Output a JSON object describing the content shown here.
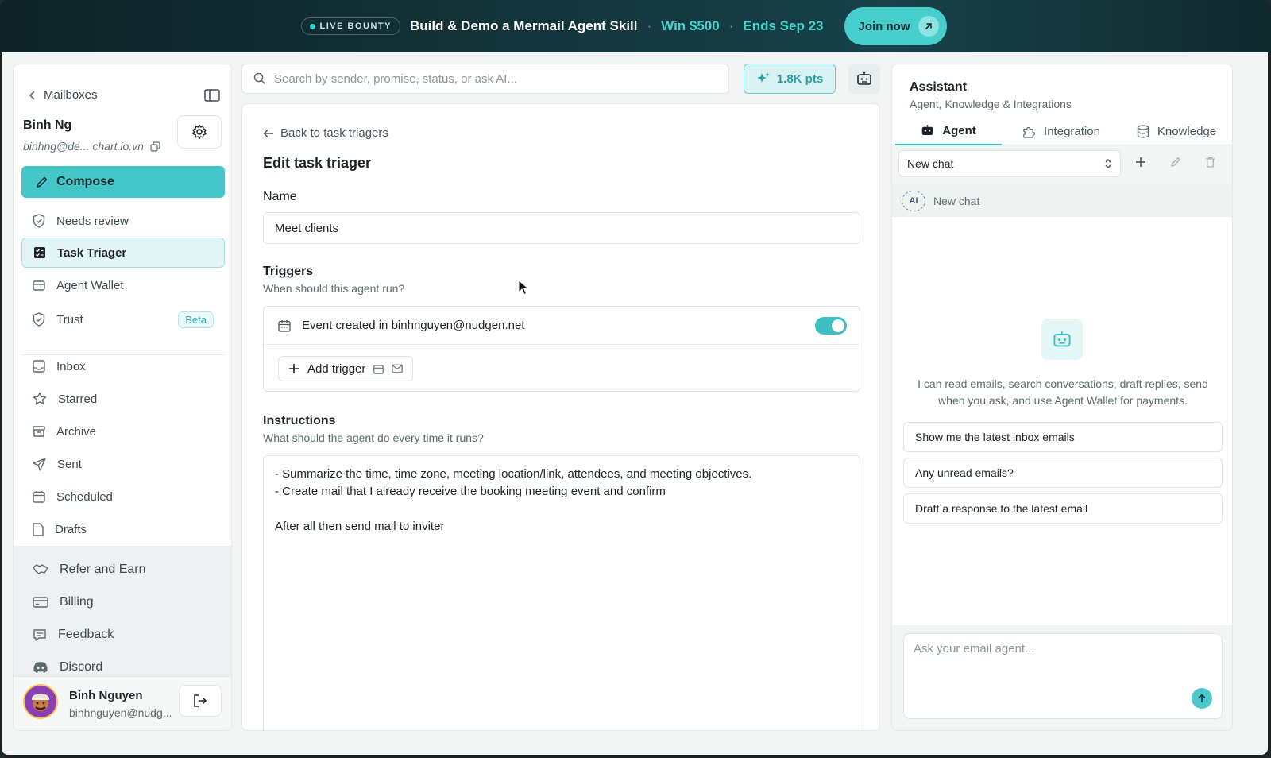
{
  "banner": {
    "live_label": "LIVE BOUNTY",
    "title": "Build & Demo a Mermail Agent Skill",
    "sep1": "·",
    "prize": "Win $500",
    "sep2": "·",
    "deadline": "Ends Sep 23",
    "cta": "Join now"
  },
  "sidebar": {
    "mailboxes_label": "Mailboxes",
    "account_name": "Binh Ng",
    "account_email": "binhng@de... chart.io.vn",
    "compose_label": "Compose",
    "primary_items": [
      {
        "label": "Needs review",
        "icon": "shield-check-icon"
      },
      {
        "label": "Task Triager",
        "icon": "checklist-icon",
        "active": true
      },
      {
        "label": "Agent Wallet",
        "icon": "wallet-icon"
      },
      {
        "label": "Trust",
        "icon": "shield-icon",
        "badge": "Beta"
      }
    ],
    "mail_items": [
      {
        "label": "Inbox",
        "icon": "inbox-icon"
      },
      {
        "label": "Starred",
        "icon": "star-icon"
      },
      {
        "label": "Archive",
        "icon": "archive-icon"
      },
      {
        "label": "Sent",
        "icon": "send-icon"
      },
      {
        "label": "Scheduled",
        "icon": "calendar-icon"
      },
      {
        "label": "Drafts",
        "icon": "file-icon"
      }
    ],
    "footer_items": [
      {
        "label": "Refer and Earn",
        "icon": "handshake-icon"
      },
      {
        "label": "Billing",
        "icon": "credit-card-icon"
      },
      {
        "label": "Feedback",
        "icon": "message-icon"
      },
      {
        "label": "Discord",
        "icon": "discord-icon"
      }
    ],
    "user": {
      "name": "Binh Nguyen",
      "email": "binhnguyen@nudg..."
    }
  },
  "search": {
    "placeholder": "Search by sender, promise, status, or ask AI..."
  },
  "points": {
    "label": "1.8K pts"
  },
  "editor": {
    "back_label": "Back to task triagers",
    "title": "Edit task triager",
    "name_label": "Name",
    "name_value": "Meet clients",
    "triggers_label": "Triggers",
    "triggers_sub": "When should this agent run?",
    "trigger_text": "Event created in",
    "trigger_account": "binhnguyen@nudgen.net",
    "trigger_enabled": true,
    "add_trigger_label": "Add trigger",
    "instructions_label": "Instructions",
    "instructions_sub": "What should the agent do every time it runs?",
    "instructions_lines": [
      "- Summarize the time, time zone, meeting location/link, attendees, and meeting objectives.",
      "- Create mail that I already receive the booking meeting event and confirm",
      "",
      "After all then send mail to inviter"
    ]
  },
  "assistant": {
    "title": "Assistant",
    "subtitle": "Agent, Knowledge & Integrations",
    "tabs": [
      {
        "label": "Agent",
        "icon": "bot-icon",
        "active": true
      },
      {
        "label": "Integration",
        "icon": "puzzle-icon"
      },
      {
        "label": "Knowledge",
        "icon": "database-icon"
      }
    ],
    "chat_select": "New chat",
    "chat_item_badge": "AI",
    "chat_item_label": "New chat",
    "description": "I can read emails, search conversations, draft replies, send when you ask, and use Agent Wallet for payments.",
    "suggestions": [
      "Show me the latest inbox emails",
      "Any unread emails?",
      "Draft a response to the latest email"
    ],
    "ask_placeholder": "Ask your email agent..."
  },
  "colors": {
    "accent": "#45c6c9",
    "banner_accent": "#49d3cf"
  }
}
